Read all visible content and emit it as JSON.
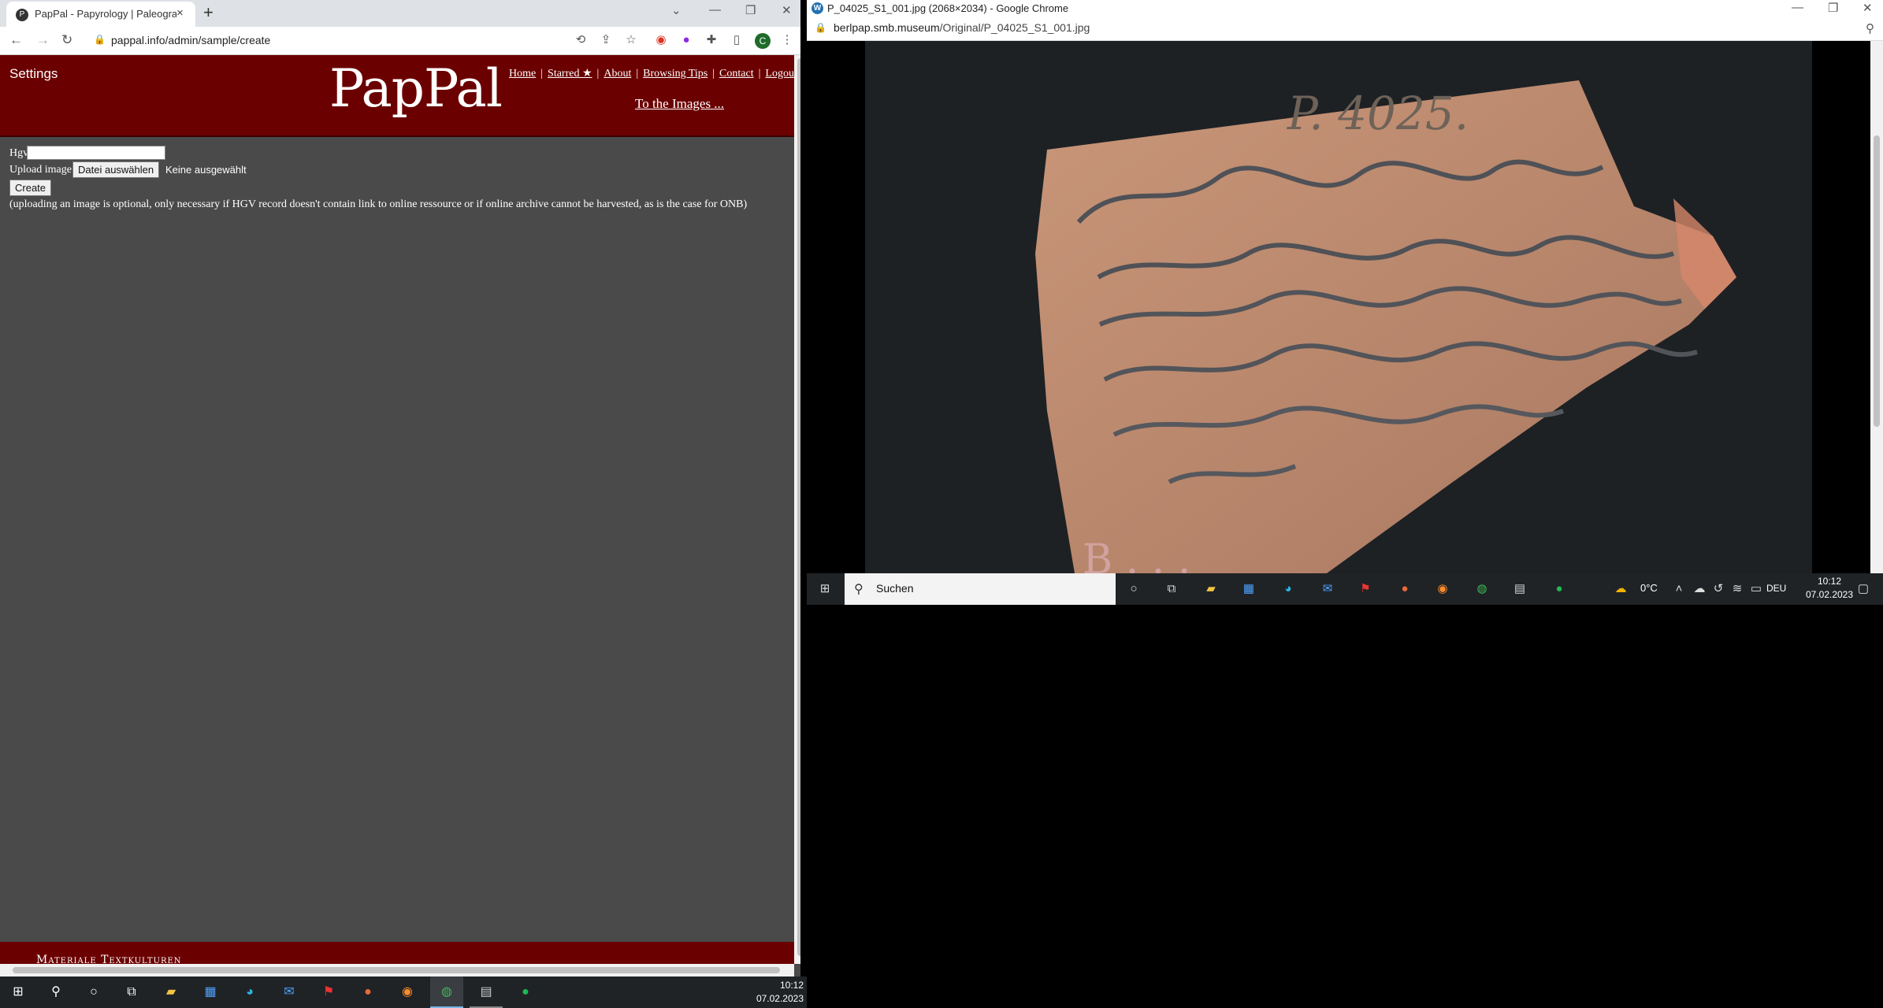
{
  "left_browser": {
    "tab_title": "PapPal - Papyrology | Paleograph",
    "url": "pappal.info/admin/sample/create",
    "profile_initial": "C"
  },
  "page": {
    "settings_label": "Settings",
    "logo": "PapPal",
    "nav": {
      "home": "Home",
      "starred": "Starred ★",
      "about": "About",
      "browsing_tips": "Browsing Tips",
      "contact": "Contact",
      "logout": "Logou"
    },
    "images_link": "To the Images ...",
    "form": {
      "hgv_label": "Hgv",
      "hgv_value": "",
      "upload_label": "Upload image",
      "file_button": "Datei auswählen",
      "file_status": "Keine ausgewählt",
      "create_button": "Create",
      "note": "(uploading an image is optional, only necessary if HGV record doesn't contain link to online ressource or if online archive cannot be harvested, as is the case for ONB)"
    },
    "footer_text": "Materiale Textkulturen"
  },
  "right_browser": {
    "title": "P_04025_S1_001.jpg (2068×2034) - Google Chrome",
    "url_domain": "berlpap.smb.museum",
    "url_path": "/Original/P_04025_S1_001.jpg",
    "image_inscription": "P. 4025."
  },
  "small_taskbar": {
    "search_label": "Suchen",
    "weather": "0°C",
    "language": "DEU",
    "time": "10:12",
    "date": "07.02.2023"
  },
  "taskbar": {
    "time": "10:12",
    "date": "07.02.2023"
  },
  "colors": {
    "header_bg": "#6b0000",
    "page_bg": "#4a4a4a"
  }
}
